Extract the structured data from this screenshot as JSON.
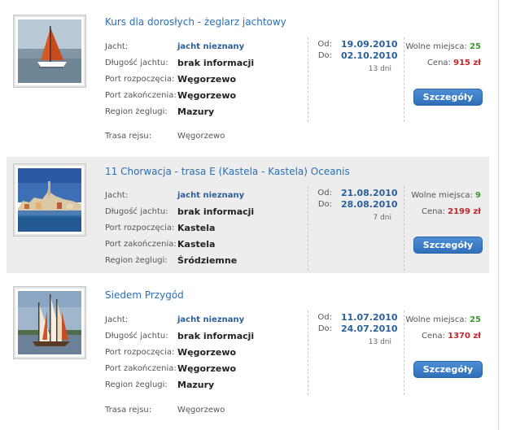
{
  "cruises": [
    {
      "title": "Kurs dla dorosłych - żeglarz jachtowy",
      "image": "sailboat-red-sail",
      "fields": [
        {
          "label": "Jacht:",
          "value": "jacht nieznany"
        },
        {
          "label": "Długość jachtu:",
          "value": "brak informacji"
        },
        {
          "label": "Port rozpoczęcia:",
          "value": "Węgorzewo"
        },
        {
          "label": "Port zakończenia:",
          "value": "Węgorzewo"
        },
        {
          "label": "Region żeglugi:",
          "value": "Mazury"
        },
        {
          "label": "Trasa rejsu:",
          "value": "Węgorzewo"
        }
      ],
      "from_label": "Od:",
      "from_date": "19.09.2010",
      "to_label": "Do:",
      "to_date": "02.10.2010",
      "days": "13 dni",
      "seats_label": "Wolne miejsca:",
      "seats": "25",
      "price_label": "Cena:",
      "price": "915 zł",
      "button": "Szczegóły"
    },
    {
      "title": "11 Chorwacja - trasa E (Kastela - Kastela) Oceanis",
      "image": "croatian-coastal-town",
      "fields": [
        {
          "label": "Jacht:",
          "value": "jacht nieznany"
        },
        {
          "label": "Długość jachtu:",
          "value": "brak informacji"
        },
        {
          "label": "Port rozpoczęcia:",
          "value": "Kastela"
        },
        {
          "label": "Port zakończenia:",
          "value": "Kastela"
        },
        {
          "label": "Region żeglugi:",
          "value": "Śródziemne"
        }
      ],
      "from_label": "Od:",
      "from_date": "21.08.2010",
      "to_label": "Do:",
      "to_date": "28.08.2010",
      "days": "7 dni",
      "seats_label": "Wolne miejsca:",
      "seats": "9",
      "price_label": "Cena:",
      "price": "2199 zł",
      "button": "Szczegóły"
    },
    {
      "title": "Siedem Przygód",
      "image": "traditional-sailboat",
      "fields": [
        {
          "label": "Jacht:",
          "value": "jacht nieznany"
        },
        {
          "label": "Długość jachtu:",
          "value": "brak informacji"
        },
        {
          "label": "Port rozpoczęcia:",
          "value": "Węgorzewo"
        },
        {
          "label": "Port zakończenia:",
          "value": "Węgorzewo"
        },
        {
          "label": "Region żeglugi:",
          "value": "Mazury"
        },
        {
          "label": "Trasa rejsu:",
          "value": "Węgorzewo"
        }
      ],
      "from_label": "Od:",
      "from_date": "11.07.2010",
      "to_label": "Do:",
      "to_date": "24.07.2010",
      "days": "13 dni",
      "seats_label": "Wolne miejsca:",
      "seats": "25",
      "price_label": "Cena:",
      "price": "1370 zł",
      "button": "Szczegóły"
    }
  ]
}
